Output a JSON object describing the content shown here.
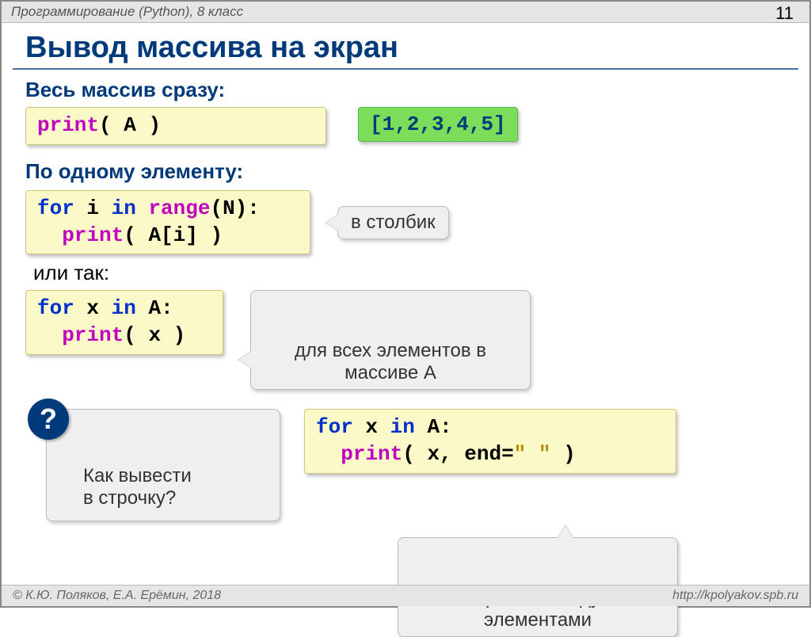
{
  "header": {
    "course": "Программирование (Python), 8 класс",
    "page": "11"
  },
  "title": "Вывод массива на экран",
  "sec1": {
    "heading": "Весь массив сразу:",
    "code_print": "print",
    "code_open": "( ",
    "code_var": "A",
    "code_close": " )",
    "output": "[1,2,3,4,5]"
  },
  "sec2": {
    "heading": "По одному элементу:",
    "l1_for": "for",
    "l1_i": " i ",
    "l1_in": "in",
    "l1_sp": " ",
    "l1_range": "range",
    "l1_args": "(N):",
    "l2_print": "print",
    "l2_open": "( ",
    "l2_arg": "A[i]",
    "l2_close": " )",
    "callout": "в столбик"
  },
  "sec3": {
    "or": "или так:",
    "l1_for": "for",
    "l1_x": " x ",
    "l1_in": "in",
    "l1_A": " A:",
    "l2_print": "print",
    "l2_open": "( ",
    "l2_arg": "x",
    "l2_close": " )",
    "callout": "для всех элементов в\nмассиве A"
  },
  "sec4": {
    "question": "Как вывести\nв строчку?",
    "qicon": "?",
    "l1_for": "for",
    "l1_x": " x ",
    "l1_in": "in",
    "l1_A": " A:",
    "l2_print": "print",
    "l2_open": "( ",
    "l2_arg": "x, end=",
    "l2_str": "\" \"",
    "l2_close": " )",
    "callout": "пробел между\nэлементами"
  },
  "footer": {
    "left": "© К.Ю. Поляков, Е.А. Ерёмин, 2018",
    "right": "http://kpolyakov.spb.ru"
  }
}
